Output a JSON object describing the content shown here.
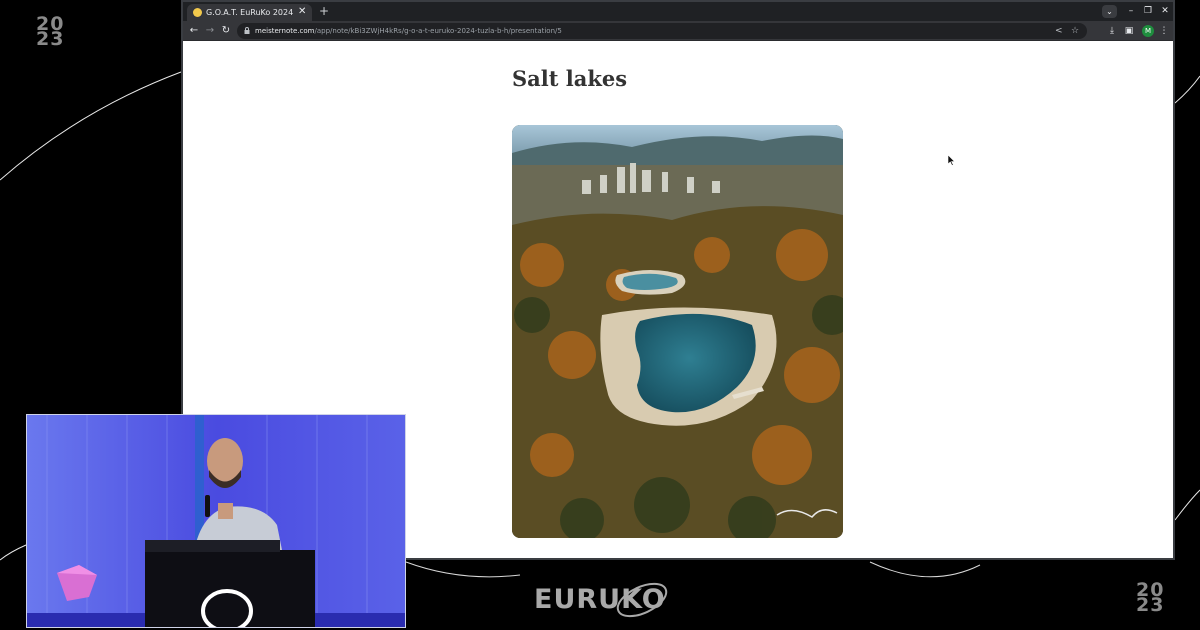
{
  "event": {
    "year_top": "20",
    "year_bottom": "23",
    "logo_text": "EURUKO"
  },
  "browser": {
    "tab": {
      "title": "G.O.A.T. EuRuKo 2024 @T"
    },
    "url": {
      "host": "meisternote.com",
      "path": "/app/note/kBi3ZWjH4kRs/g-o-a-t-euruko-2024-tuzla-b-h/presentation/5"
    },
    "profile_initial": "M",
    "icons": {
      "tab_close": "close-icon",
      "new_tab": "plus-icon",
      "back": "arrow-left-icon",
      "forward": "arrow-right-icon",
      "reload": "reload-icon",
      "lock": "lock-icon",
      "share": "share-icon",
      "bookmark": "star-icon",
      "download": "download-icon",
      "sidebar": "side-panel-icon",
      "menu": "kebab-menu-icon",
      "tab_search": "chevron-down-icon",
      "minimize": "minimize-icon",
      "restore": "restore-icon",
      "close_window": "close-icon"
    }
  },
  "slide": {
    "title": "Salt lakes",
    "image_description": "aerial-photo-salt-lakes-city"
  },
  "colors": {
    "video_bg": "#3d3ccf",
    "browser_chrome": "#35363a",
    "tab_strip": "#1f2124",
    "title_text": "#333333"
  }
}
